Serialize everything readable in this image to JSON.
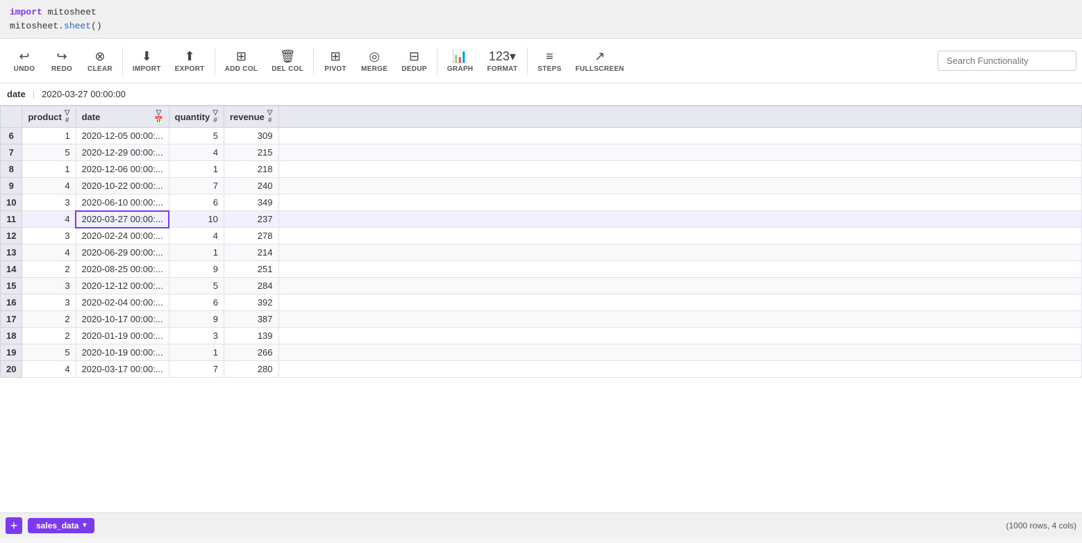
{
  "code": {
    "line1": "import mitosheet",
    "line2": "mitosheet.sheet()",
    "kw": "import",
    "fn": "sheet"
  },
  "toolbar": {
    "undo_label": "UNDO",
    "redo_label": "REDO",
    "clear_label": "CLEAR",
    "import_label": "IMPORT",
    "export_label": "EXPORT",
    "add_col_label": "ADD COL",
    "del_col_label": "DEL COL",
    "pivot_label": "PIVOT",
    "merge_label": "MERGE",
    "dedup_label": "DEDUP",
    "graph_label": "GRAPH",
    "format_label": "FORMAT",
    "steps_label": "STEPS",
    "fullscreen_label": "FULLSCREEN",
    "search_placeholder": "Search Functionality"
  },
  "formula_bar": {
    "cell_ref": "date",
    "cell_value": "2020-03-27 00:00:00"
  },
  "columns": [
    {
      "name": "product",
      "type": "#"
    },
    {
      "name": "date",
      "type": "calendar"
    },
    {
      "name": "quantity",
      "type": "#"
    },
    {
      "name": "revenue",
      "type": "#"
    }
  ],
  "rows": [
    {
      "idx": 6,
      "product": 1,
      "date": "2020-12-05 00:00:...",
      "quantity": 5,
      "revenue": 309,
      "active": false,
      "selected_date": false
    },
    {
      "idx": 7,
      "product": 5,
      "date": "2020-12-29 00:00:...",
      "quantity": 4,
      "revenue": 215,
      "active": false,
      "selected_date": false
    },
    {
      "idx": 8,
      "product": 1,
      "date": "2020-12-06 00:00:...",
      "quantity": 1,
      "revenue": 218,
      "active": false,
      "selected_date": false
    },
    {
      "idx": 9,
      "product": 4,
      "date": "2020-10-22 00:00:...",
      "quantity": 7,
      "revenue": 240,
      "active": false,
      "selected_date": false
    },
    {
      "idx": 10,
      "product": 3,
      "date": "2020-06-10 00:00:...",
      "quantity": 6,
      "revenue": 349,
      "active": false,
      "selected_date": false
    },
    {
      "idx": 11,
      "product": 4,
      "date": "2020-03-27 00:00:...",
      "quantity": 10,
      "revenue": 237,
      "active": true,
      "selected_date": true
    },
    {
      "idx": 12,
      "product": 3,
      "date": "2020-02-24 00:00:...",
      "quantity": 4,
      "revenue": 278,
      "active": false,
      "selected_date": false
    },
    {
      "idx": 13,
      "product": 4,
      "date": "2020-06-29 00:00:...",
      "quantity": 1,
      "revenue": 214,
      "active": false,
      "selected_date": false
    },
    {
      "idx": 14,
      "product": 2,
      "date": "2020-08-25 00:00:...",
      "quantity": 9,
      "revenue": 251,
      "active": false,
      "selected_date": false
    },
    {
      "idx": 15,
      "product": 3,
      "date": "2020-12-12 00:00:...",
      "quantity": 5,
      "revenue": 284,
      "active": false,
      "selected_date": false
    },
    {
      "idx": 16,
      "product": 3,
      "date": "2020-02-04 00:00:...",
      "quantity": 6,
      "revenue": 392,
      "active": false,
      "selected_date": false
    },
    {
      "idx": 17,
      "product": 2,
      "date": "2020-10-17 00:00:...",
      "quantity": 9,
      "revenue": 387,
      "active": false,
      "selected_date": false
    },
    {
      "idx": 18,
      "product": 2,
      "date": "2020-01-19 00:00:...",
      "quantity": 3,
      "revenue": 139,
      "active": false,
      "selected_date": false
    },
    {
      "idx": 19,
      "product": 5,
      "date": "2020-10-19 00:00:...",
      "quantity": 1,
      "revenue": 266,
      "active": false,
      "selected_date": false
    },
    {
      "idx": 20,
      "product": 4,
      "date": "2020-03-17 00:00:...",
      "quantity": 7,
      "revenue": 280,
      "active": false,
      "selected_date": false
    }
  ],
  "tab": {
    "name": "sales_data",
    "row_count": "(1000 rows, 4 cols)"
  }
}
